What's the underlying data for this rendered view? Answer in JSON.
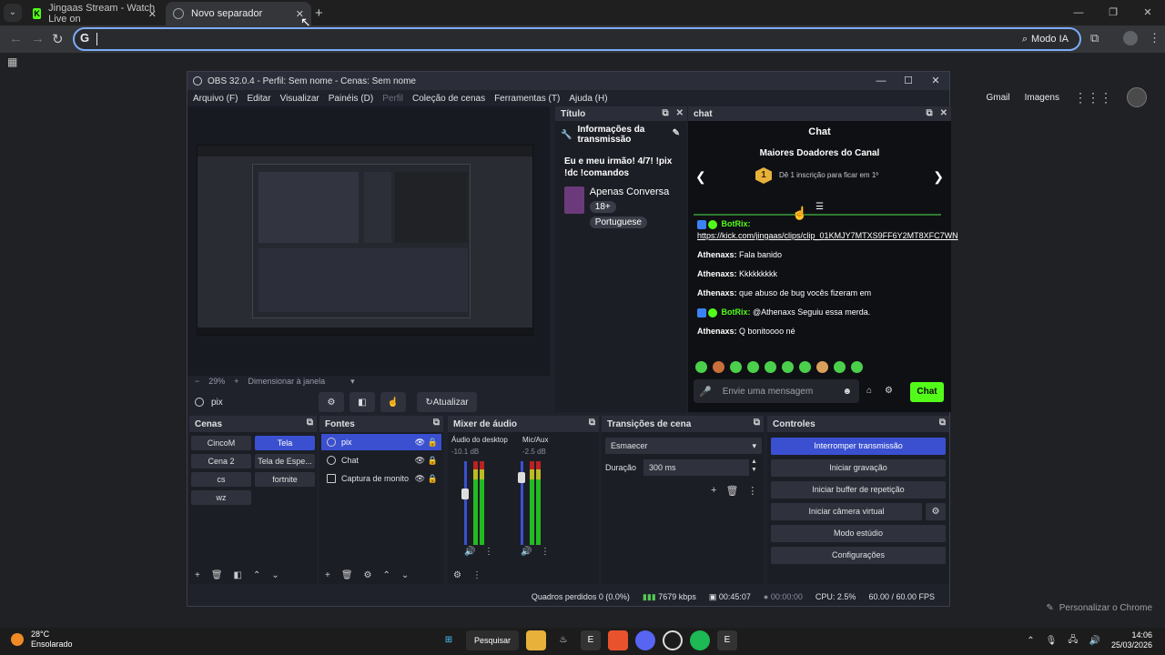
{
  "browser": {
    "tabs": [
      {
        "title": "Jingaas Stream - Watch Live on",
        "fav": "K"
      },
      {
        "title": "Novo separador"
      }
    ],
    "omnibox": {
      "g": "G",
      "value": "",
      "ai_label": "Modo IA"
    },
    "google_links": {
      "gmail": "Gmail",
      "images": "Imagens"
    },
    "personalize": "Personalizar o Chrome"
  },
  "obs": {
    "title": "OBS 32.0.4 - Perfil: Sem nome - Cenas: Sem nome",
    "menu": [
      "Arquivo (F)",
      "Editar",
      "Visualizar",
      "Painéis (D)",
      "Perfil",
      "Coleção de cenas",
      "Ferramentas (T)",
      "Ajuda (H)"
    ],
    "zoom": {
      "minus": "−",
      "value": "29%",
      "plus": "+",
      "fit": "Dimensionar à janela"
    },
    "source_bar": {
      "name": "pix",
      "refresh": "Atualizar"
    },
    "titulo_dock": {
      "head": "Título",
      "info": "Informações da transmissão",
      "stream_title": "Eu e meu irmão! 4/7! !pix !dc !comandos",
      "category": "Apenas Conversa",
      "tags": [
        "18+",
        "Portuguese"
      ]
    },
    "chat_dock": {
      "head": "chat",
      "header": "Chat",
      "donors_title": "Maiores Doadores do Canal",
      "donor_rank": "1",
      "donor_text": "Dê 1 inscrição para ficar em 1º",
      "messages": [
        {
          "user": "BotRix:",
          "text": "",
          "link": "https://kick.com/jingaas/clips/clip_01KMJY7MTXS9FF6Y2MT8XFC7WN",
          "bot": true
        },
        {
          "user": "Athenaxs:",
          "text": "Fala banido"
        },
        {
          "user": "Athenaxs:",
          "text": "Kkkkkkkkk"
        },
        {
          "user": "Athenaxs:",
          "text": "que abuso de bug vocês fizeram em"
        },
        {
          "user": "BotRix:",
          "text": "@Athenaxs Seguiu essa merda.",
          "bot": true
        },
        {
          "user": "Athenaxs:",
          "text": "Q bonitoooo né"
        }
      ],
      "input_placeholder": "Envie uma mensagem",
      "send": "Chat"
    },
    "cenas": {
      "head": "Cenas",
      "scenes": [
        "CincoM",
        "Tela",
        "Cena 2",
        "Tela de Espe...",
        "cs",
        "fortnite",
        "wz"
      ],
      "active": "Tela"
    },
    "fontes": {
      "head": "Fontes",
      "items": [
        "pix",
        "Chat",
        "Captura de monito"
      ]
    },
    "mixer": {
      "head": "Mixer de áudio",
      "channels": [
        {
          "name": "Áudio do desktop",
          "db": "-10.1 dB"
        },
        {
          "name": "Mic/Aux",
          "db": "-2.5 dB"
        }
      ]
    },
    "transicoes": {
      "head": "Transições de cena",
      "selected": "Esmaecer",
      "duration_label": "Duração",
      "duration": "300 ms"
    },
    "controles": {
      "head": "Controles",
      "buttons": [
        "Interromper transmissão",
        "Iniciar gravação",
        "Iniciar buffer de repetição",
        "Iniciar câmera virtual",
        "Modo estúdio",
        "Configurações"
      ]
    },
    "status": {
      "dropped": "Quadros perdidos 0 (0.0%)",
      "bitrate": "7679 kbps",
      "stream_time": "00:45:07",
      "rec_time": "00:00:00",
      "cpu": "CPU: 2.5%",
      "fps": "60.00 / 60.00 FPS"
    }
  },
  "taskbar": {
    "temp": "28°C",
    "weather": "Ensolarado",
    "search": "Pesquisar",
    "time": "14:06",
    "date": "25/03/2026"
  },
  "colors": {
    "accent": "#3a50d0",
    "kick_green": "#53fc18",
    "omnibox_border": "#7cacf8"
  }
}
